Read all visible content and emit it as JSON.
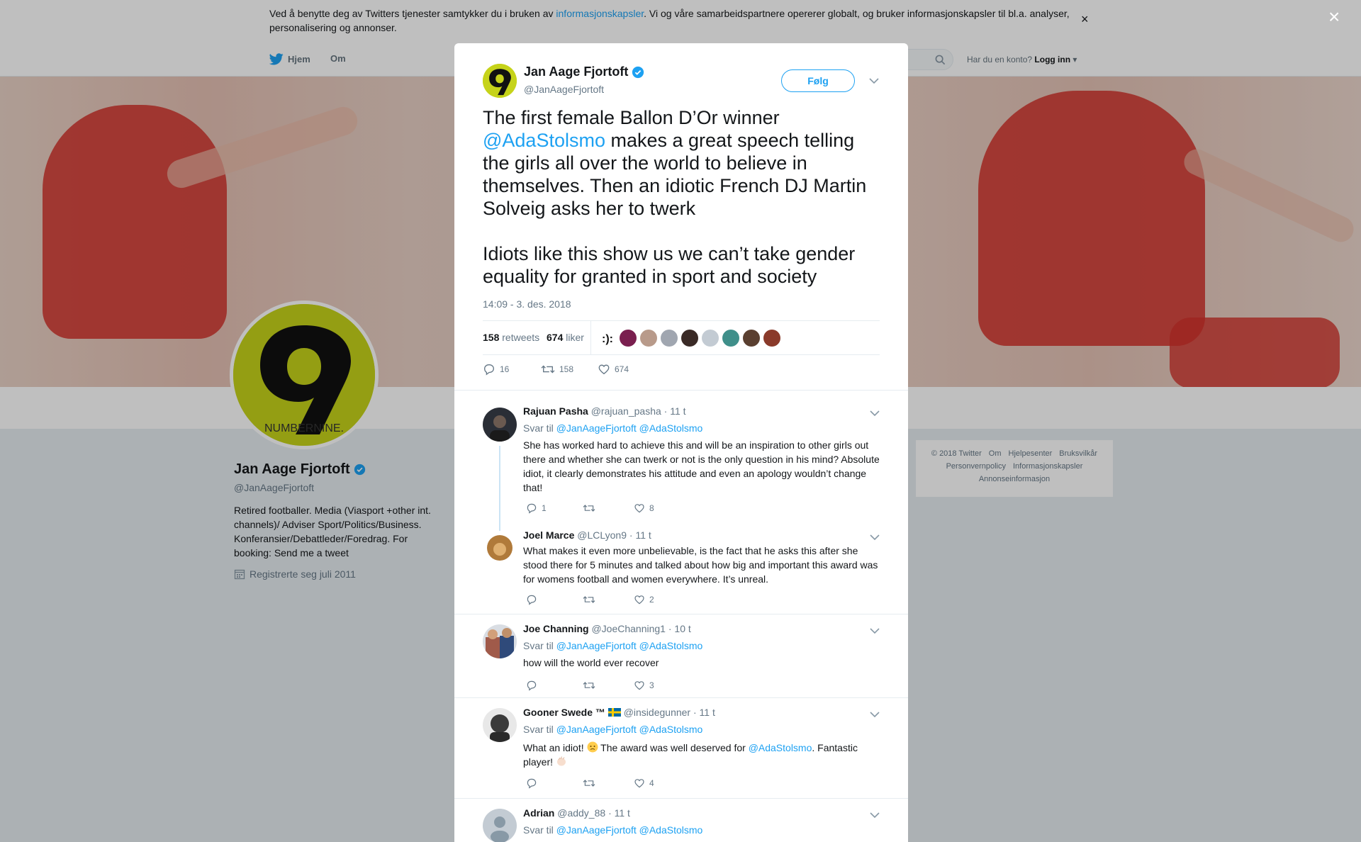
{
  "cookie": {
    "text_before": "Ved å benytte deg av Twitters tjenester samtykker du i bruken av ",
    "link": "informasjonskapsler",
    "text_after": ". Vi og våre samarbeidspartnere opererer globalt, og bruker informasjonskapsler til bl.a. analyser, personalisering og annonser.",
    "close": "×"
  },
  "nav": {
    "home": "Hjem",
    "about": "Om",
    "login_prompt": "Har du en konto?",
    "login": "Logg inn"
  },
  "profile": {
    "name": "Jan Aage Fjortoft",
    "handle": "@JanAageFjortoft",
    "bio": "Retired footballer. Media (Viasport +other int. channels)/ Adviser Sport/Politics/Business. Konferansier/Debattleder/Foredrag. For booking: Send me a tweet",
    "joined": "Registrerte seg juli 2011",
    "avatar_text": "NUMBERNINE."
  },
  "footer": {
    "items": [
      "© 2018 Twitter",
      "Om",
      "Hjelpesenter",
      "Bruksvilkår",
      "Personvernpolicy",
      "Informasjonskapsler",
      "Annonseinformasjon"
    ]
  },
  "overlay_close": "×",
  "tweet": {
    "name": "Jan Aage Fjortoft",
    "handle": "@JanAageFjortoft",
    "follow": "Følg",
    "text_1a": "The first female Ballon D’Or winner ",
    "text_1_mention": "@AdaStolsmo",
    "text_1b": " makes a great speech telling the girls all over the world to believe in themselves. Then an idiotic French DJ Martin Solveig asks her to twerk",
    "text_2": "Idiots like this show us we can’t take gender equality for granted in sport and society",
    "time": "14:09 - 3. des. 2018",
    "retweets_count": "158",
    "retweets_label": "retweets",
    "likes_count": "674",
    "likes_label": "liker",
    "likers_colors": [
      "#ffffff",
      "#7a1f4f",
      "#b89a8a",
      "#a0a6b0",
      "#3a2a26",
      "#c3cbd3",
      "#3f8f8a",
      "#5a3f30",
      "#8a3a2a"
    ],
    "reply_count": "16",
    "retweet_count": "158",
    "like_count": "674"
  },
  "replies": [
    {
      "name": "Rajuan Pasha",
      "handle": "@rajuan_pasha",
      "time": "· 11 t",
      "reply_label": "Svar til",
      "reply_to_1": "@JanAageFjortoft",
      "reply_to_2": "@AdaStolsmo",
      "text": "She has worked hard to achieve this and will be an inspiration to other girls out there and whether she can twerk or not is the only question in his mind? Absolute idiot, it clearly demonstrates his attitude and even an apology wouldn’t change that!",
      "reply_count": "1",
      "retweet_count": "",
      "like_count": "8",
      "avatar_color": "#2a2e36"
    },
    {
      "name": "Joel Marce",
      "handle": "@LCLyon9",
      "time": "· 11 t",
      "text": "What makes it even more unbelievable, is the fact that he asks this after she stood there for 5 minutes and talked about how big and important this award was for womens football and women everywhere. It’s unreal.",
      "reply_count": "",
      "retweet_count": "",
      "like_count": "2",
      "avatar_color": "#b07a3a"
    },
    {
      "name": "Joe Channing",
      "handle": "@JoeChanning1",
      "time": "· 10 t",
      "reply_label": "Svar til",
      "reply_to_1": "@JanAageFjortoft",
      "reply_to_2": "@AdaStolsmo",
      "text": "how will the world ever recover",
      "reply_count": "",
      "retweet_count": "",
      "like_count": "3",
      "avatar_color": "#a05a4a"
    },
    {
      "name": "Gooner Swede ™",
      "handle": "@insidegunner",
      "time": "· 11 t",
      "reply_label": "Svar til",
      "reply_to_1": "@JanAageFjortoft",
      "reply_to_2": "@AdaStolsmo",
      "text_a": "What an idiot!",
      "text_b": "The award was well deserved for",
      "text_mention": "@AdaStolsmo",
      "text_c": ". Fantastic player!",
      "reply_count": "",
      "retweet_count": "",
      "like_count": "4",
      "avatar_color": "#3a3a3a"
    },
    {
      "name": "Adrian",
      "handle": "@addy_88",
      "time": "· 11 t",
      "reply_label": "Svar til",
      "reply_to_1": "@JanAageFjortoft",
      "reply_to_2": "@AdaStolsmo",
      "avatar_color": "#c3cbd3"
    }
  ],
  "colors": {
    "accent": "#1da1f2",
    "avatar_green": "#c6d31a",
    "overlay": "rgba(0,0,0,0.25)"
  }
}
